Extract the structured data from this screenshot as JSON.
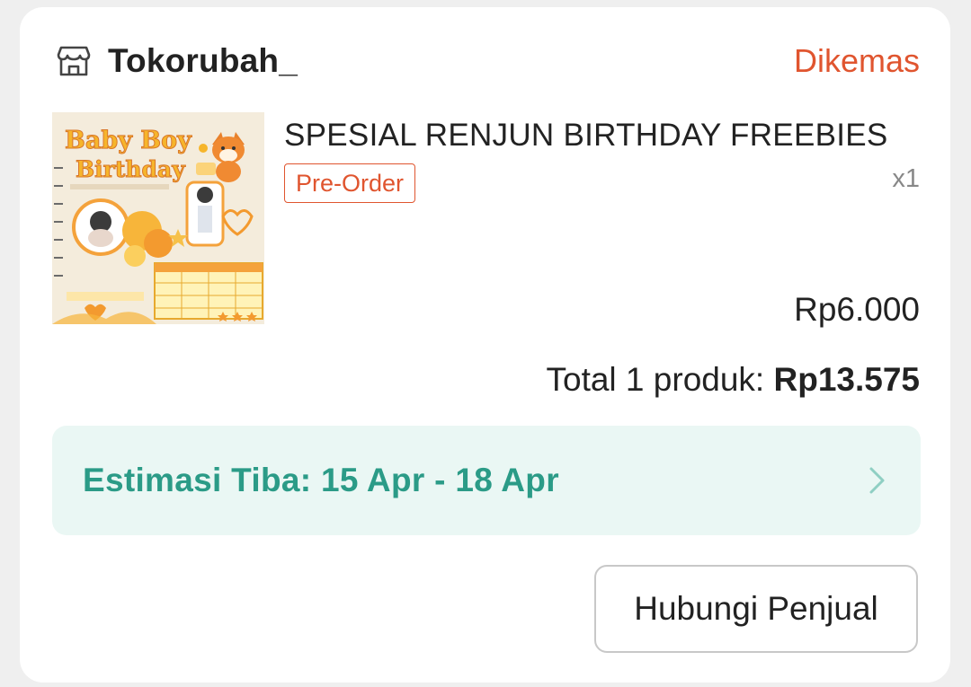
{
  "shop": {
    "icon": "store-icon",
    "name": "Tokorubah_",
    "status": "Dikemas"
  },
  "product": {
    "thumbnail_icon": "product-image",
    "thumbnail_text": {
      "line1": "Baby Boy",
      "line2": "Birthday"
    },
    "title": "SPESIAL RENJUN BIRTHDAY FREEBIES",
    "badge": "Pre-Order",
    "quantity": "x1",
    "price": "Rp6.000"
  },
  "summary": {
    "total_label": "Total 1 produk:",
    "total_amount": "Rp13.575"
  },
  "eta": {
    "label": "Estimasi Tiba: 15 Apr - 18 Apr",
    "icon": "chevron-right-icon"
  },
  "actions": {
    "contact_seller": "Hubungi Penjual"
  },
  "colors": {
    "accent": "#e0552f",
    "eta_text": "#2b9b87",
    "eta_bg": "#eaf7f4"
  }
}
